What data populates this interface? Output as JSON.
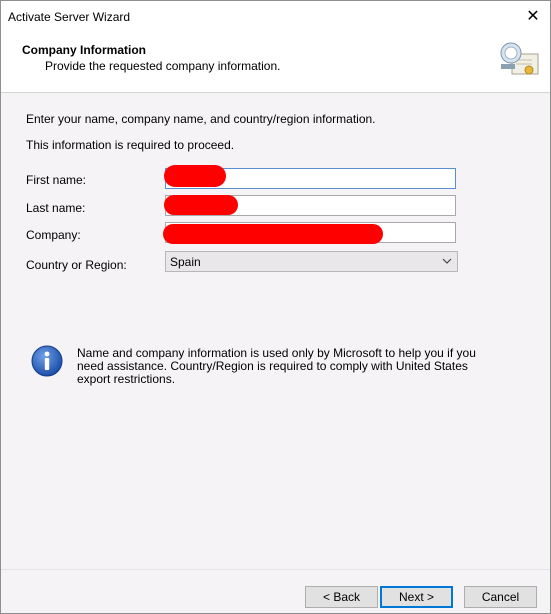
{
  "window": {
    "title": "Activate Server Wizard",
    "close_glyph": "✕"
  },
  "header": {
    "title": "Company Information",
    "subtitle": "Provide the requested company information.",
    "icon": "certificate-icon"
  },
  "intro": {
    "line1": "Enter your name, company name, and country/region information.",
    "line2": "This information is required to proceed."
  },
  "form": {
    "first_name_label": "First name:",
    "last_name_label": "Last name:",
    "company_label": "Company:",
    "country_label": "Country or Region:",
    "country_value": "Spain"
  },
  "info": {
    "icon": "info-icon",
    "text": "Name and company information is used only by Microsoft to help you if you need assistance. Country/Region is required to comply with United States export restrictions."
  },
  "buttons": {
    "back": "< Back",
    "next": "Next >",
    "cancel": "Cancel"
  },
  "colors": {
    "redaction": "#ff0000",
    "body_bg": "#f5f3f6",
    "focus_border": "#5a8ed1"
  }
}
